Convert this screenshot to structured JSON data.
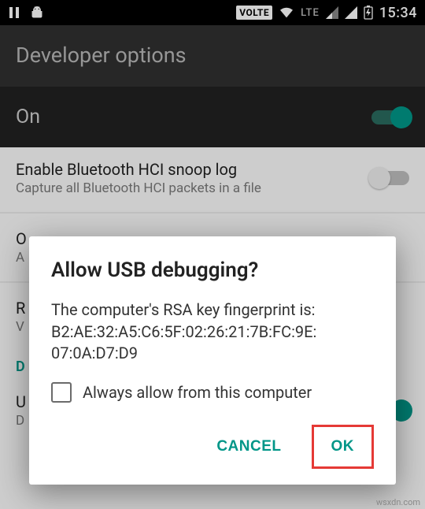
{
  "status": {
    "time": "15:34",
    "volte": "VOLTE",
    "lte": "LTE"
  },
  "header": {
    "title": "Developer options",
    "master_toggle": "On"
  },
  "rows": {
    "bt_snoop": {
      "title": "Enable Bluetooth HCI snoop log",
      "subtitle": "Capture all Bluetooth HCI packets in a file"
    },
    "oem": {
      "title_initial": "O",
      "subtitle_initial": "A"
    },
    "r": {
      "title_initial": "R",
      "subtitle_initial": "V"
    },
    "section": "D",
    "u": {
      "title_initial": "U",
      "subtitle_initial": "D"
    }
  },
  "dialog": {
    "title": "Allow USB debugging?",
    "message": "The computer's RSA key fingerprint is:\nB2:AE:32:A5:C6:5F:02:26:21:7B:FC:9E:\n07:0A:D7:D9",
    "checkbox_label": "Always allow from this computer",
    "cancel": "CANCEL",
    "ok": "OK"
  },
  "watermark": "wsxdn.com"
}
